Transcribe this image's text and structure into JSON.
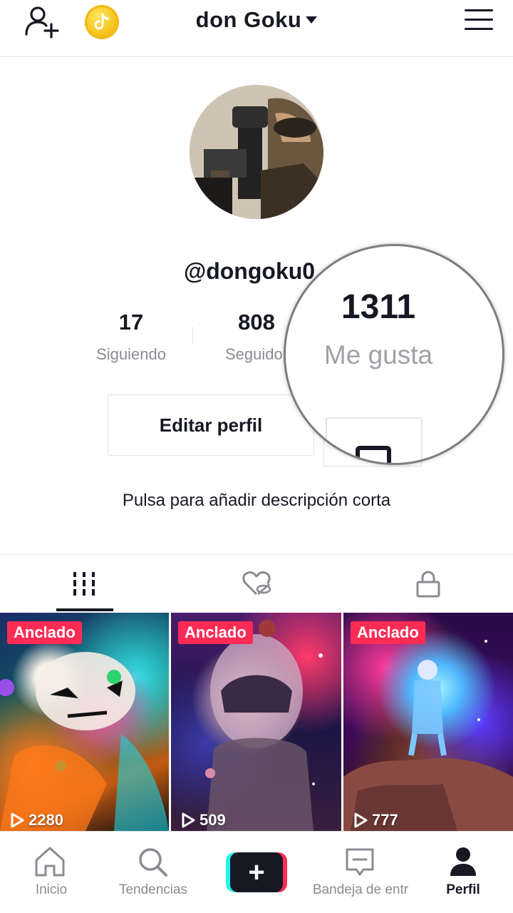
{
  "header": {
    "username": "don Goku",
    "add_user_icon": "person-add-icon",
    "coin_icon": "tiktok-coin-icon",
    "menu_icon": "hamburger-menu-icon"
  },
  "profile": {
    "handle": "@dongoku0",
    "bio_placeholder": "Pulsa para añadir descripción corta",
    "edit_profile_label": "Editar perfil"
  },
  "stats": {
    "following": {
      "value": "17",
      "label": "Siguiendo"
    },
    "followers": {
      "value": "808",
      "label": "Seguidor"
    },
    "likes": {
      "value": "1311",
      "label": "Me gusta"
    }
  },
  "tabs": [
    {
      "icon": "grid-videos-icon",
      "active": true
    },
    {
      "icon": "liked-hidden-icon",
      "active": false
    },
    {
      "icon": "lock-icon",
      "active": false
    }
  ],
  "videos": [
    {
      "badge": "Anclado",
      "views": "2280"
    },
    {
      "badge": "Anclado",
      "views": "509"
    },
    {
      "badge": "Anclado",
      "views": "777"
    }
  ],
  "bottom_nav": [
    {
      "label": "Inicio",
      "icon": "home-icon"
    },
    {
      "label": "Tendencias",
      "icon": "search-icon"
    },
    {
      "label": "",
      "icon": "create-plus-icon"
    },
    {
      "label": "Bandeja de entr",
      "icon": "inbox-icon"
    },
    {
      "label": "Perfil",
      "icon": "profile-icon",
      "active": true
    }
  ],
  "colors": {
    "accent": "#fe2c55",
    "cyan": "#25f4ee",
    "text": "#161823",
    "muted": "#8a8b91"
  }
}
